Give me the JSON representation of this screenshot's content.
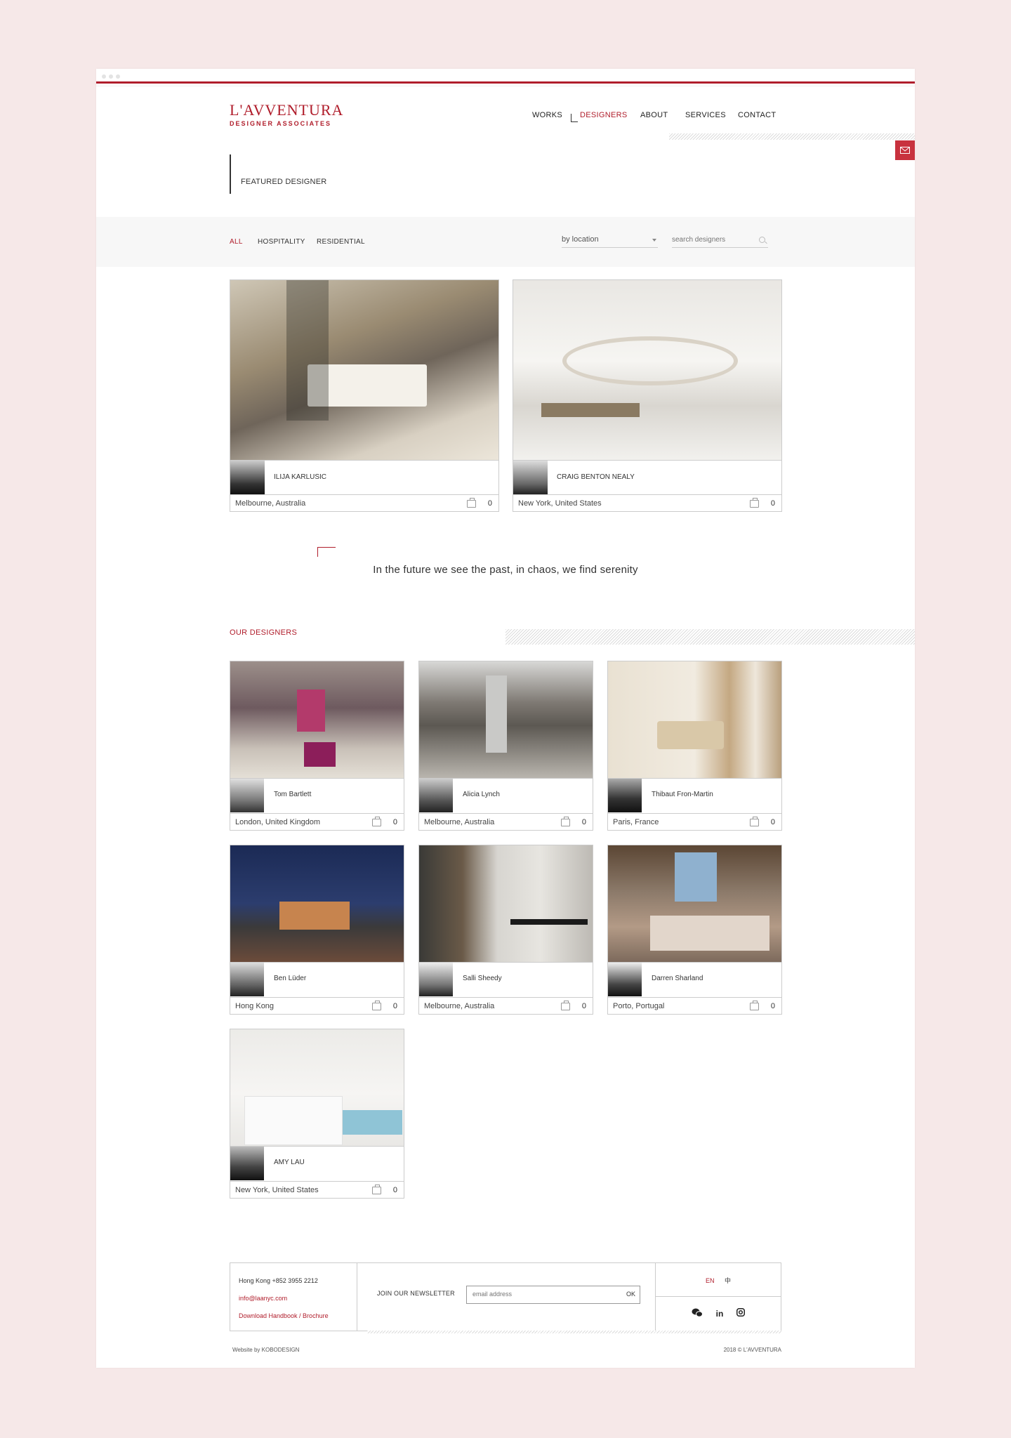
{
  "brand": {
    "name": "L'AVVENTURA",
    "tagline": "DESIGNER ASSOCIATES",
    "accent": "#b01d2b"
  },
  "nav": {
    "items": [
      "WORKS",
      "DESIGNERS",
      "ABOUT",
      "SERVICES",
      "CONTACT"
    ],
    "active": "DESIGNERS"
  },
  "icons": {
    "mail": "envelope-icon",
    "search": "search-icon",
    "bag": "portfolio-bag-icon",
    "wechat": "wechat-icon",
    "linkedin": "linkedin-icon",
    "instagram": "instagram-icon"
  },
  "featured": {
    "label": "FEATURED DESIGNER",
    "cards": [
      {
        "name": "ILIJA KARLUSIC",
        "location": "Melbourne, Australia",
        "count": "0"
      },
      {
        "name": "CRAIG BENTON NEALY",
        "location": "New York, United States",
        "count": "0"
      }
    ]
  },
  "filters": {
    "tabs": [
      "ALL",
      "HOSPITALITY",
      "RESIDENTIAL"
    ],
    "active": "ALL",
    "location_select": "by location",
    "search_placeholder": "search designers"
  },
  "quote": "In the future we see the past, in chaos, we find serenity",
  "designers": {
    "heading": "OUR DESIGNERS",
    "cards": [
      {
        "name": "Tom Bartlett",
        "location": "London, United Kingdom",
        "count": "0"
      },
      {
        "name": "Alicia Lynch",
        "location": "Melbourne, Australia",
        "count": "0"
      },
      {
        "name": "Thibaut Fron-Martin",
        "location": "Paris, France",
        "count": "0"
      },
      {
        "name": "Ben Lüder",
        "location": "Hong Kong",
        "count": "0"
      },
      {
        "name": "Salli Sheedy",
        "location": "Melbourne, Australia",
        "count": "0"
      },
      {
        "name": "Darren Sharland",
        "location": "Porto, Portugal",
        "count": "0"
      },
      {
        "name": "AMY LAU",
        "location": "New York, United States",
        "count": "0"
      }
    ]
  },
  "footer": {
    "phone": "Hong Kong +852 3955 2212",
    "email": "info@laanyc.com",
    "download": "Download Handbook / Brochure",
    "newsletter_label": "JOIN OUR NEWSLETTER",
    "email_placeholder": "email address",
    "ok": "OK",
    "lang_en": "EN",
    "lang_zh": "中",
    "linkedin": "in",
    "credit_left": "Website by KOBODESIGN",
    "credit_right": "2018 © L'AVVENTURA"
  }
}
